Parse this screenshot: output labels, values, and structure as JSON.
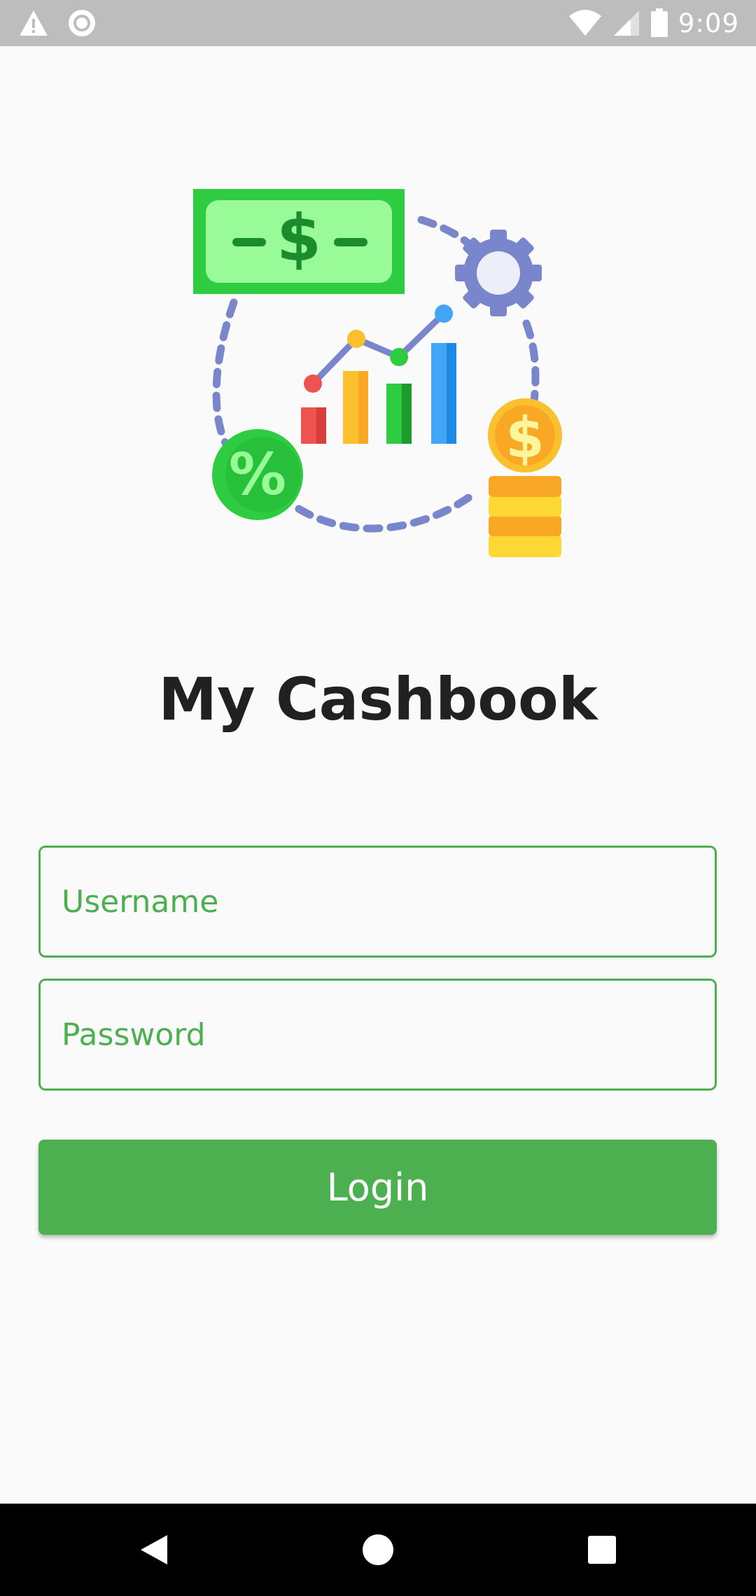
{
  "status_bar": {
    "time": "9:09",
    "icons": [
      "alert-icon",
      "record-icon",
      "wifi-icon",
      "signal-icon",
      "battery-icon"
    ]
  },
  "illustration": {
    "icon": "finance-illustration",
    "bill_symbol": "$",
    "coin_symbol": "$",
    "percent_symbol": "%"
  },
  "app": {
    "title": "My Cashbook"
  },
  "form": {
    "username_placeholder": "Username",
    "username_value": "",
    "password_placeholder": "Password",
    "password_value": "",
    "login_label": "Login"
  },
  "colors": {
    "accent": "#4caf50",
    "status_bar": "#bdbdbd",
    "nav_bar": "#000000",
    "title": "#212121"
  },
  "nav_bar": {
    "buttons": [
      "back-icon",
      "home-icon",
      "recents-icon"
    ]
  }
}
